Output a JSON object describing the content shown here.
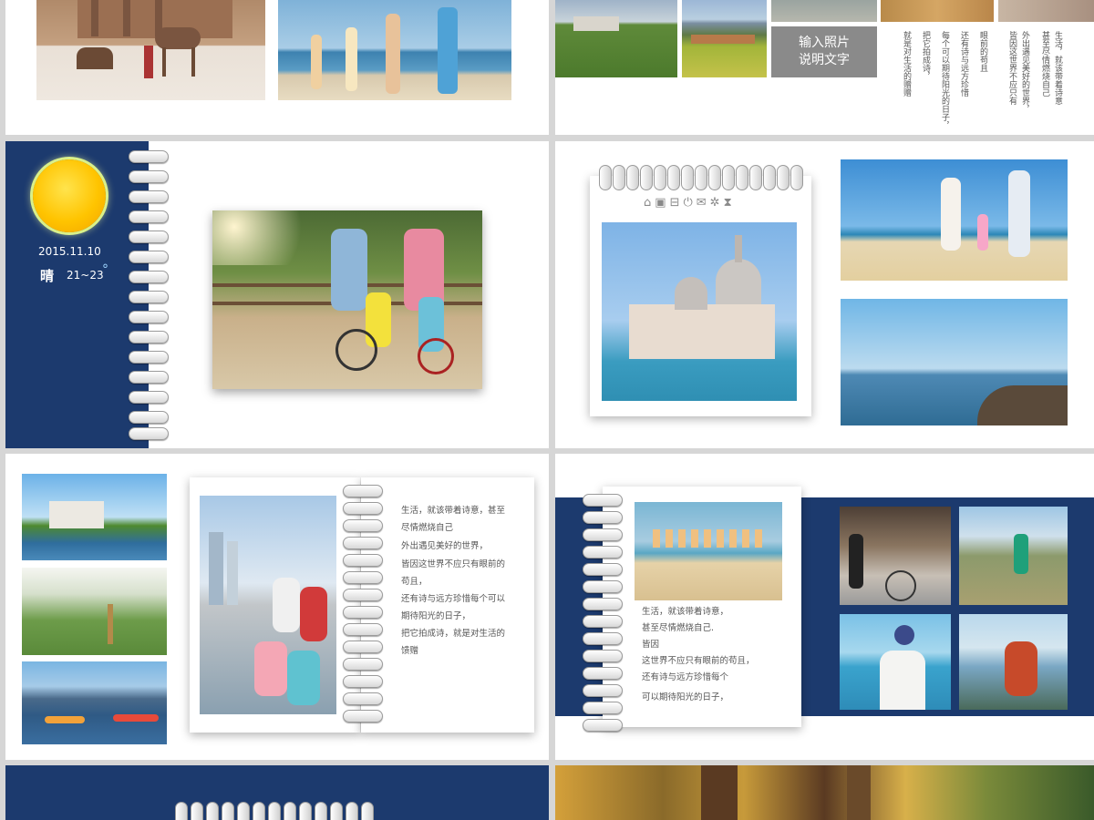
{
  "slide2": {
    "caption_box": "输入照片\n说明文字",
    "vertical_lines": [
      "生活，就该带着诗意",
      "甚至尽情燃烧自己",
      "外出遇见美好的世界，",
      "皆因这世界不应只有",
      "眼前的苟且",
      "还有诗与远方珍惜",
      "每个可以期待阳光的日子，",
      "把它拍成诗，",
      "就是对生活的赠赠"
    ]
  },
  "slide3": {
    "date": "2015.11.10",
    "weather": "晴",
    "temperature": "21~23",
    "degree_mark": "°"
  },
  "slide4": {
    "toolbar_icons": [
      "home-icon",
      "tv-icon",
      "briefcase-icon",
      "power-icon",
      "mail-icon",
      "gear-icon",
      "hourglass-icon"
    ]
  },
  "slide5": {
    "paragraphs": [
      "生活，就该带着诗意，甚至尽情燃烧自己",
      "外出遇见美好的世界，",
      "皆因这世界不应只有眼前的苟且，",
      "还有诗与远方珍惜每个可以期待阳光的日子，",
      "把它拍成诗，就是对生活的馈赠"
    ]
  },
  "slide6": {
    "lines": [
      "生活，就该带着诗意，",
      "甚至尽情燃烧自己.",
      "皆因",
      "这世界不应只有眼前的苟且，",
      "还有诗与远方珍惜每个",
      "可以期待阳光的日子，"
    ]
  },
  "colors": {
    "navy": "#1c3a6e",
    "sun": "#f7b500",
    "gray_box": "#8a8a8a"
  }
}
